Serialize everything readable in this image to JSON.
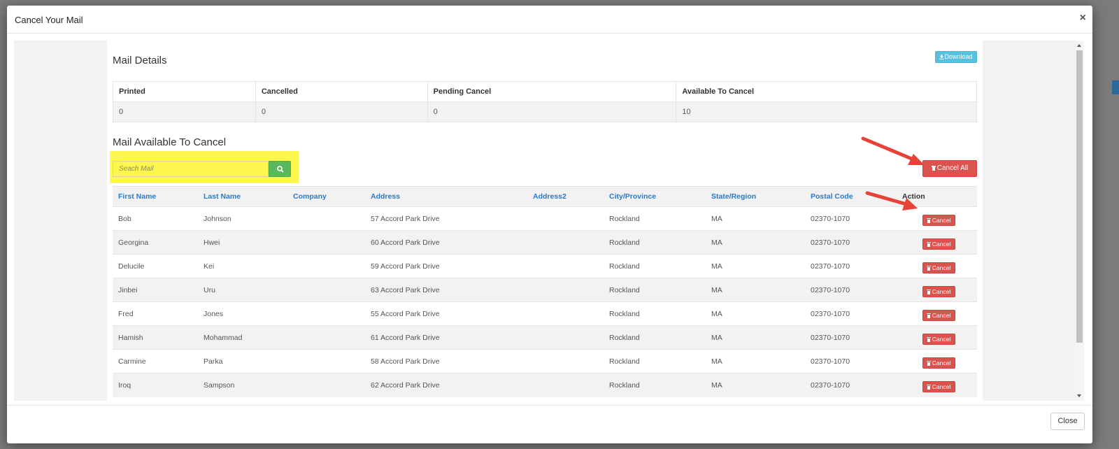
{
  "modal": {
    "title": "Cancel Your Mail",
    "close_symbol": "×",
    "close_button_label": "Close"
  },
  "details": {
    "title": "Mail Details",
    "download_label": "Download",
    "headers": [
      "Printed",
      "Cancelled",
      "Pending Cancel",
      "Available To Cancel"
    ],
    "values": [
      "0",
      "0",
      "0",
      "10"
    ]
  },
  "available": {
    "title": "Mail Available To Cancel",
    "search_placeholder": "Seach Mail",
    "cancel_all_label": "Cancel All",
    "row_cancel_label": "Cancel",
    "headers": [
      "First Name",
      "Last Name",
      "Company",
      "Address",
      "Address2",
      "City/Province",
      "State/Region",
      "Postal Code",
      "Action"
    ],
    "rows": [
      {
        "first": "Bob",
        "last": "Johnson",
        "company": "",
        "address": "57 Accord Park Drive",
        "address2": "",
        "city": "Rockland",
        "state": "MA",
        "postal": "02370-1070"
      },
      {
        "first": "Georgina",
        "last": "Hwei",
        "company": "",
        "address": "60 Accord Park Drive",
        "address2": "",
        "city": "Rockland",
        "state": "MA",
        "postal": "02370-1070"
      },
      {
        "first": "Delucile",
        "last": "Kei",
        "company": "",
        "address": "59 Accord Park Drive",
        "address2": "",
        "city": "Rockland",
        "state": "MA",
        "postal": "02370-1070"
      },
      {
        "first": "Jinbei",
        "last": "Uru",
        "company": "",
        "address": "63 Accord Park Drive",
        "address2": "",
        "city": "Rockland",
        "state": "MA",
        "postal": "02370-1070"
      },
      {
        "first": "Fred",
        "last": "Jones",
        "company": "",
        "address": "55 Accord Park Drive",
        "address2": "",
        "city": "Rockland",
        "state": "MA",
        "postal": "02370-1070"
      },
      {
        "first": "Hamish",
        "last": "Mohammad",
        "company": "",
        "address": "61 Accord Park Drive",
        "address2": "",
        "city": "Rockland",
        "state": "MA",
        "postal": "02370-1070"
      },
      {
        "first": "Carmine",
        "last": "Parka",
        "company": "",
        "address": "58 Accord Park Drive",
        "address2": "",
        "city": "Rockland",
        "state": "MA",
        "postal": "02370-1070"
      },
      {
        "first": "Iroq",
        "last": "Sampson",
        "company": "",
        "address": "62 Accord Park Drive",
        "address2": "",
        "city": "Rockland",
        "state": "MA",
        "postal": "02370-1070"
      }
    ]
  },
  "colors": {
    "highlight": "#fef74e",
    "danger": "#d9534f",
    "success": "#5cb85c",
    "info": "#5bc0de",
    "link": "#2a7ac9",
    "annotation_arrow": "#e8413a"
  },
  "icons": {
    "download": "download-icon",
    "search": "search-icon",
    "trash": "trash-icon"
  }
}
